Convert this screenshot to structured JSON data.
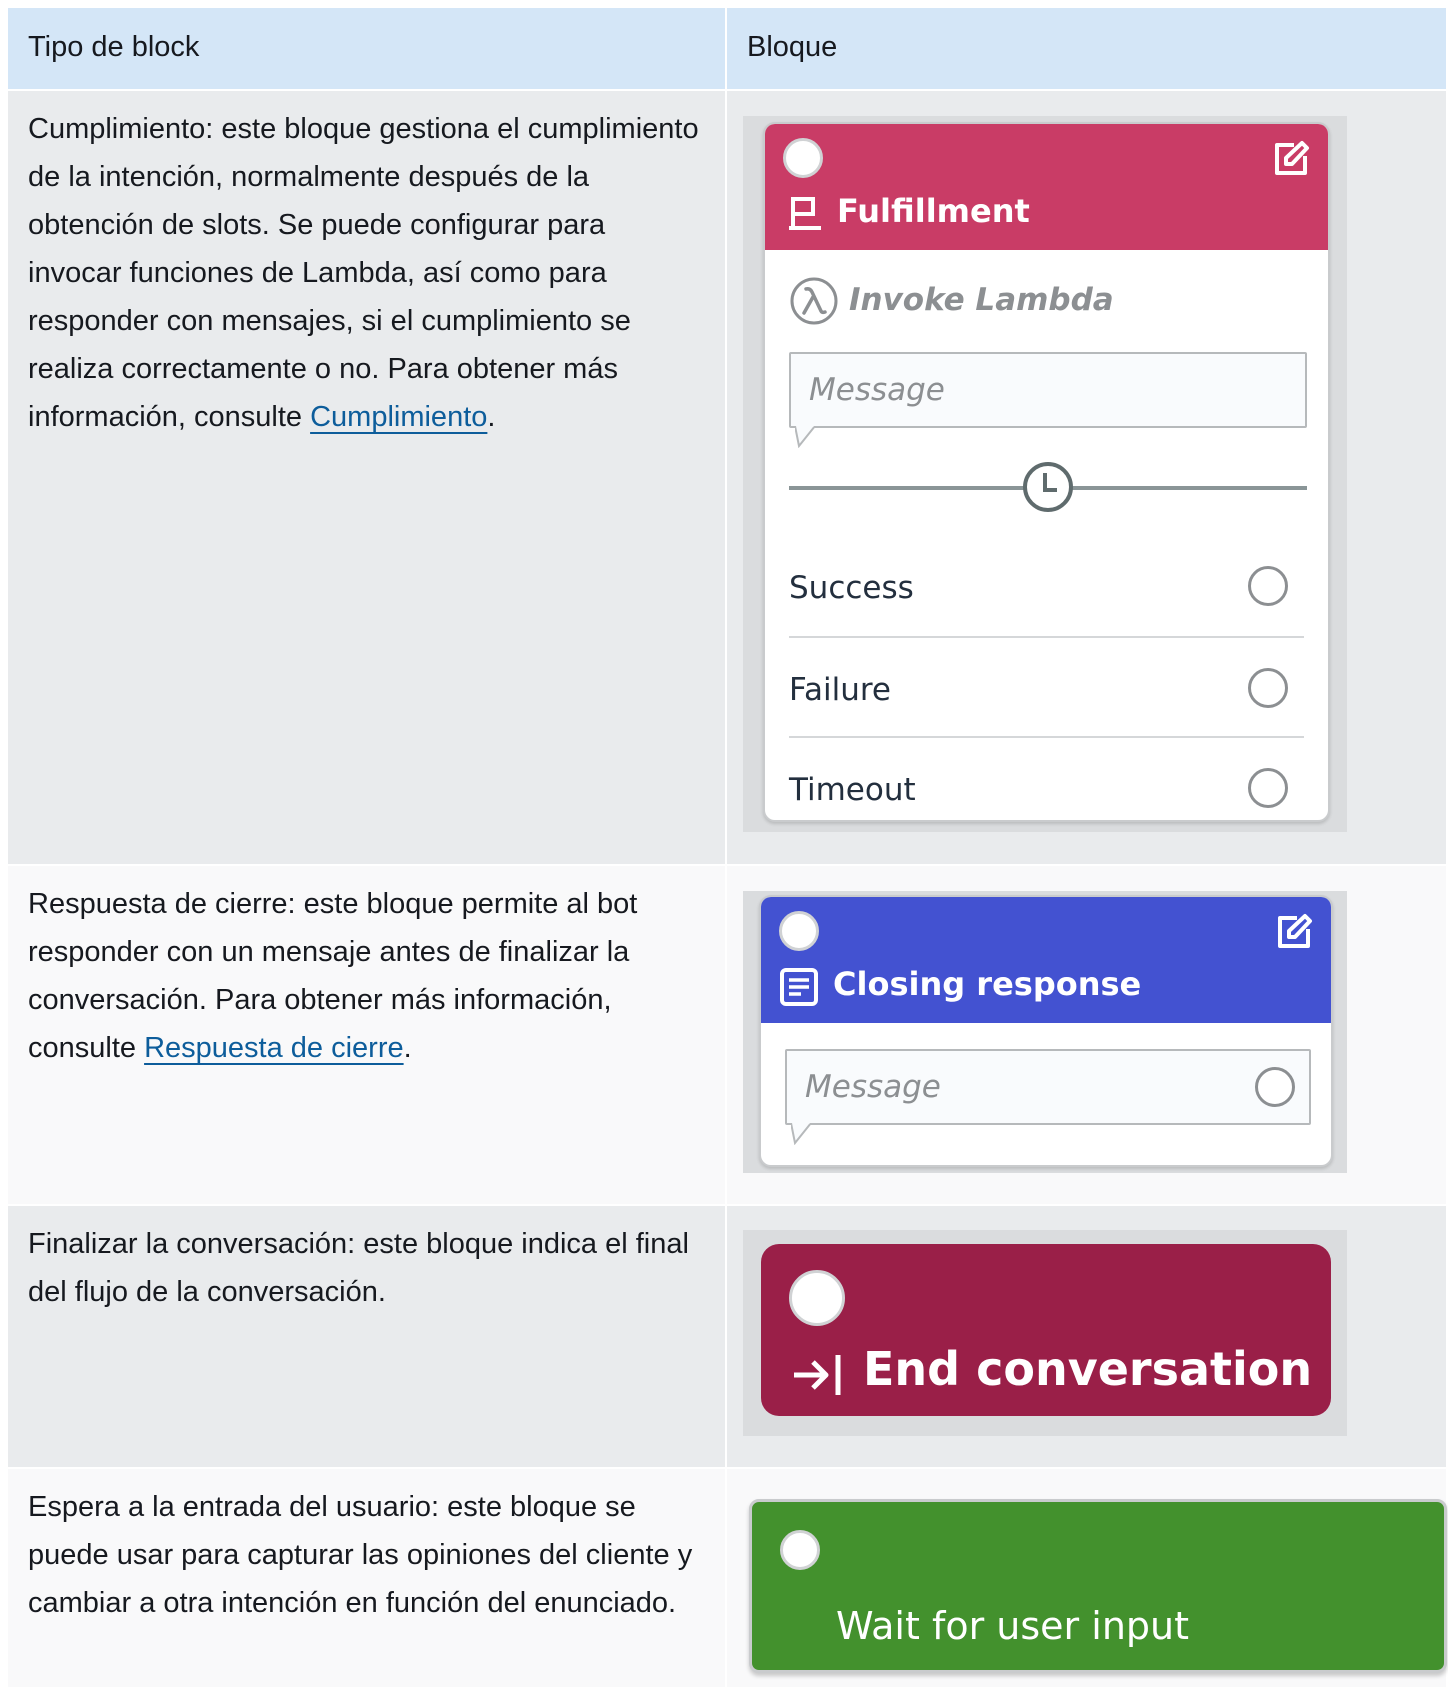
{
  "table": {
    "headers": [
      "Tipo de block",
      "Bloque"
    ],
    "rows": [
      {
        "desc_before": "Cumplimiento: este bloque gestiona el cumplimiento de la intención, normalmente después de la obtención de slots. Se puede configurar para invocar funciones de Lambda, así como para responder con mensajes, si el cumplimiento se realiza correctamente o no. Para obtener más información, consulte ",
        "link": "Cumplimiento",
        "desc_after": "."
      },
      {
        "desc_before": "Respuesta de cierre: este bloque permite al bot responder con un mensaje antes de finalizar la conversación. Para obtener más información, consulte ",
        "link": "Respuesta de cierre",
        "desc_after": "."
      },
      {
        "desc_before": "Finalizar la conversación: este bloque indica el final del flujo de la conversación.",
        "link": "",
        "desc_after": ""
      },
      {
        "desc_before": "Espera a la entrada del usuario: este bloque se puede usar para capturar las opiniones del cliente y cambiar a otra intención en función del enunciado.",
        "link": "",
        "desc_after": ""
      }
    ]
  },
  "blocks": {
    "fulfillment": {
      "title": "Fulfillment",
      "lambda": "Invoke Lambda",
      "message_placeholder": "Message",
      "outcomes": [
        "Success",
        "Failure",
        "Timeout"
      ],
      "color": "#c93c66"
    },
    "closing": {
      "title": "Closing response",
      "message_placeholder": "Message",
      "color": "#4352d1"
    },
    "end": {
      "title": "End conversation",
      "color": "#9a1f48"
    },
    "wait": {
      "title": "Wait for user input",
      "color": "#43912d"
    }
  },
  "icons": [
    "edit-icon",
    "flag-icon",
    "lambda-icon",
    "clock-icon",
    "document-icon",
    "arrow-to-bar-icon"
  ]
}
